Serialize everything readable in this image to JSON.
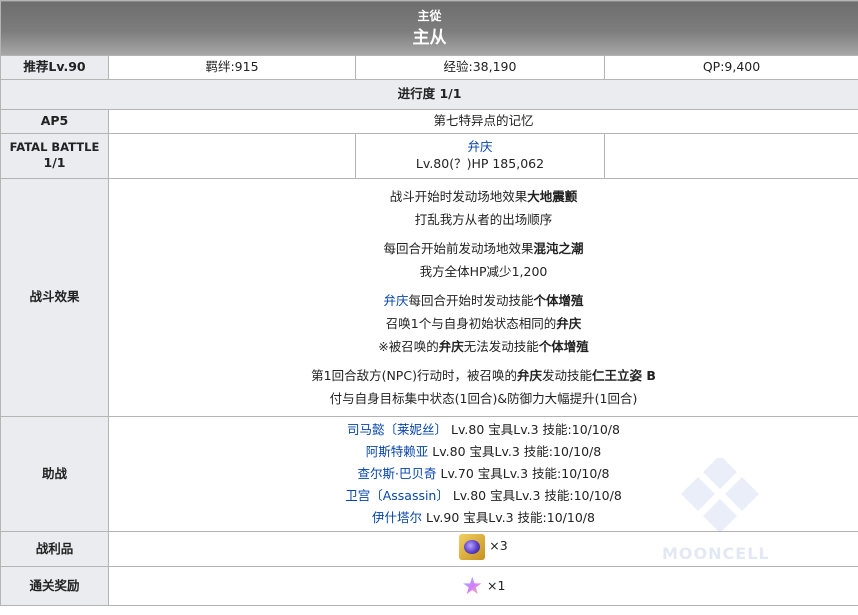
{
  "banner": {
    "subtitle": "主從",
    "title": "主从"
  },
  "summary": {
    "recommended_label": "推荐Lv.90",
    "bond": "羁绊:915",
    "exp": "经验:38,190",
    "qp": "QP:9,400"
  },
  "progress": "进行度 1/1",
  "ap": {
    "label": "AP5",
    "location": "第七特异点的记忆"
  },
  "fatal": {
    "label_line1": "FATAL BATTLE",
    "label_line2": "1/1",
    "enemy_name": "弁庆",
    "enemy_stats": "Lv.80(？)HP 185,062"
  },
  "effects": {
    "label": "战斗效果",
    "block1": {
      "l1_pre": "战斗开始时发动场地效果",
      "l1_bold": "大地震颤",
      "l2": "打乱我方从者的出场顺序"
    },
    "block2": {
      "l1_pre": "每回合开始前发动场地效果",
      "l1_bold": "混沌之潮",
      "l2": "我方全体HP减少1,200"
    },
    "block3": {
      "l1_link": "弁庆",
      "l1_mid": "每回合开始时发动技能",
      "l1_bold": "个体增殖",
      "l2_pre": "召唤1个与自身初始状态相同的",
      "l2_bold": "弁庆",
      "l3_pre": "※被召唤的",
      "l3_bold1": "弁庆",
      "l3_mid": "无法发动技能",
      "l3_bold2": "个体增殖"
    },
    "block4": {
      "l1_pre": "第1回合敌方(NPC)行动时，被召唤的",
      "l1_bold1": "弁庆",
      "l1_mid": "发动技能",
      "l1_bold2": "仁王立姿 B",
      "l2": "付与自身目标集中状态(1回合)&防御力大幅提升(1回合)"
    }
  },
  "support": {
    "label": "助战",
    "rows": [
      {
        "name": "司马懿〔莱妮丝〕",
        "detail": " Lv.80 宝具Lv.3 技能:10/10/8"
      },
      {
        "name": "阿斯特赖亚",
        "detail": " Lv.80 宝具Lv.3 技能:10/10/8"
      },
      {
        "name": "查尔斯·巴贝奇",
        "detail": " Lv.70 宝具Lv.3 技能:10/10/8"
      },
      {
        "name": "卫宫〔Assassin〕",
        "detail": " Lv.80 宝具Lv.3 技能:10/10/8"
      },
      {
        "name": "伊什塔尔",
        "detail": " Lv.90 宝具Lv.3 技能:10/10/8"
      }
    ]
  },
  "drops": {
    "label": "战利品",
    "count": "×3",
    "icon": "purple-gem-item-icon"
  },
  "clear_reward": {
    "label": "通关奖励",
    "count": "×1",
    "icon": "rainbow-star-quartz-icon"
  },
  "watermark": {
    "text": "MOONCELL"
  }
}
